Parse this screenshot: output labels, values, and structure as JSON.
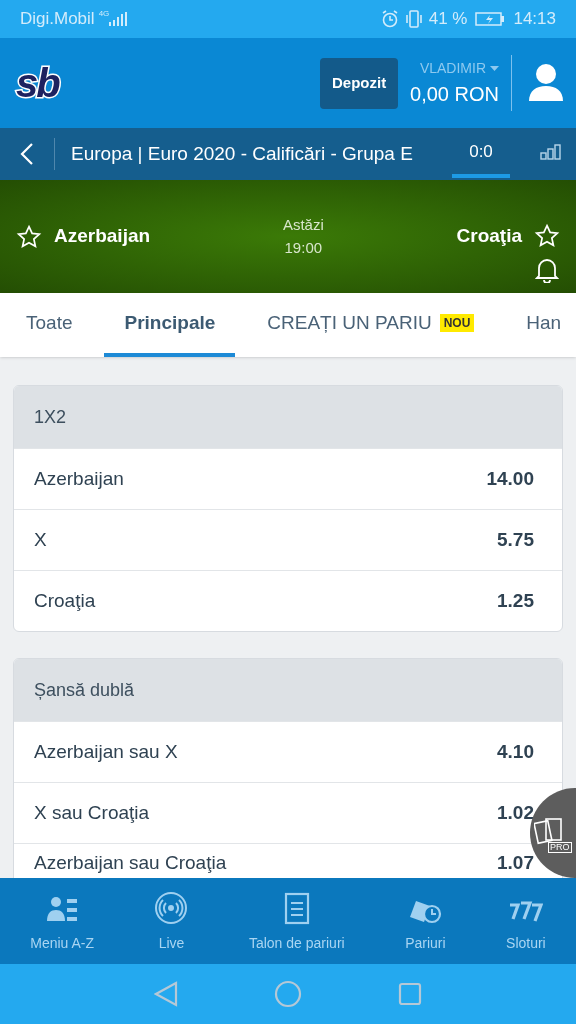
{
  "status_bar": {
    "carrier": "Digi.Mobil",
    "network": "4G",
    "battery": "41 %",
    "time": "14:13"
  },
  "header": {
    "logo": "sb",
    "deposit_button": "Depozit",
    "user": "VLADIMIR",
    "balance": "0,00 RON"
  },
  "breadcrumb": {
    "title": "Europa | Euro 2020 - Calificări - Grupa E",
    "views": [
      {
        "label": "0:0",
        "selected": true
      },
      {
        "kind": "stats",
        "selected": false
      }
    ]
  },
  "match": {
    "home": "Azerbaijan",
    "away": "Croaţia",
    "day": "Astăzi",
    "time": "19:00"
  },
  "tabs": [
    {
      "label": "Toate",
      "selected": false
    },
    {
      "label": "Principale",
      "selected": true
    },
    {
      "label": "CREAȚI UN PARIU",
      "badge": "NOU",
      "selected": false
    },
    {
      "label": "Han",
      "selected": false
    }
  ],
  "markets": [
    {
      "title": "1X2",
      "rows": [
        {
          "label": "Azerbaijan",
          "odds": "14.00"
        },
        {
          "label": "X",
          "odds": "5.75"
        },
        {
          "label": "Croaţia",
          "odds": "1.25"
        }
      ]
    },
    {
      "title": "Șansă dublă",
      "rows": [
        {
          "label": "Azerbaijan sau X",
          "odds": "4.10"
        },
        {
          "label": "X sau Croaţia",
          "odds": "1.02"
        },
        {
          "label": "Azerbaijan sau Croaţia",
          "odds": "1.07"
        }
      ]
    }
  ],
  "floating_button": {
    "badge": "PRO"
  },
  "bottom_nav": [
    {
      "label": "Meniu A-Z",
      "kind": "menu"
    },
    {
      "label": "Live",
      "kind": "live"
    },
    {
      "label": "Talon de pariuri",
      "kind": "slip"
    },
    {
      "label": "Pariuri",
      "kind": "bets"
    },
    {
      "label": "Sloturi",
      "kind": "slots"
    }
  ]
}
